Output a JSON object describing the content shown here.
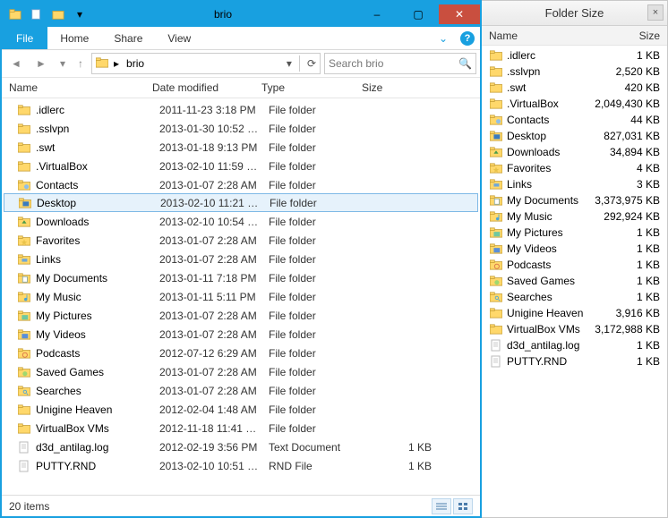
{
  "window": {
    "title": "brio",
    "minimize": "–",
    "maximize": "▢",
    "close": "✕"
  },
  "ribbon": {
    "file": "File",
    "home": "Home",
    "share": "Share",
    "view": "View"
  },
  "address": {
    "crumb_sep": "▸",
    "crumb": "brio",
    "refresh": "⟳"
  },
  "search": {
    "placeholder": "Search brio"
  },
  "columns": {
    "name": "Name",
    "date": "Date modified",
    "type": "Type",
    "size": "Size"
  },
  "selected_index": 5,
  "rows": [
    {
      "name": ".idlerc",
      "date": "2011-11-23 3:18 PM",
      "type": "File folder",
      "size": "",
      "icon": "folder"
    },
    {
      "name": ".sslvpn",
      "date": "2013-01-30 10:52 …",
      "type": "File folder",
      "size": "",
      "icon": "folder"
    },
    {
      "name": ".swt",
      "date": "2013-01-18 9:13 PM",
      "type": "File folder",
      "size": "",
      "icon": "folder"
    },
    {
      "name": ".VirtualBox",
      "date": "2013-02-10 11:59 …",
      "type": "File folder",
      "size": "",
      "icon": "folder"
    },
    {
      "name": "Contacts",
      "date": "2013-01-07 2:28 AM",
      "type": "File folder",
      "size": "",
      "icon": "contacts"
    },
    {
      "name": "Desktop",
      "date": "2013-02-10 11:21 …",
      "type": "File folder",
      "size": "",
      "icon": "desktop"
    },
    {
      "name": "Downloads",
      "date": "2013-02-10 10:54 …",
      "type": "File folder",
      "size": "",
      "icon": "downloads"
    },
    {
      "name": "Favorites",
      "date": "2013-01-07 2:28 AM",
      "type": "File folder",
      "size": "",
      "icon": "favorites"
    },
    {
      "name": "Links",
      "date": "2013-01-07 2:28 AM",
      "type": "File folder",
      "size": "",
      "icon": "links"
    },
    {
      "name": "My Documents",
      "date": "2013-01-11 7:18 PM",
      "type": "File folder",
      "size": "",
      "icon": "documents"
    },
    {
      "name": "My Music",
      "date": "2013-01-11 5:11 PM",
      "type": "File folder",
      "size": "",
      "icon": "music"
    },
    {
      "name": "My Pictures",
      "date": "2013-01-07 2:28 AM",
      "type": "File folder",
      "size": "",
      "icon": "pictures"
    },
    {
      "name": "My Videos",
      "date": "2013-01-07 2:28 AM",
      "type": "File folder",
      "size": "",
      "icon": "videos"
    },
    {
      "name": "Podcasts",
      "date": "2012-07-12 6:29 AM",
      "type": "File folder",
      "size": "",
      "icon": "podcasts"
    },
    {
      "name": "Saved Games",
      "date": "2013-01-07 2:28 AM",
      "type": "File folder",
      "size": "",
      "icon": "games"
    },
    {
      "name": "Searches",
      "date": "2013-01-07 2:28 AM",
      "type": "File folder",
      "size": "",
      "icon": "searches"
    },
    {
      "name": "Unigine Heaven",
      "date": "2012-02-04 1:48 AM",
      "type": "File folder",
      "size": "",
      "icon": "folder"
    },
    {
      "name": "VirtualBox VMs",
      "date": "2012-11-18 11:41 …",
      "type": "File folder",
      "size": "",
      "icon": "folder"
    },
    {
      "name": "d3d_antilag.log",
      "date": "2012-02-19 3:56 PM",
      "type": "Text Document",
      "size": "1 KB",
      "icon": "file"
    },
    {
      "name": "PUTTY.RND",
      "date": "2013-02-10 10:51 …",
      "type": "RND File",
      "size": "1 KB",
      "icon": "file"
    }
  ],
  "status": {
    "count": "20 items"
  },
  "side": {
    "title": "Folder Size",
    "close": "×",
    "col_name": "Name",
    "col_size": "Size",
    "rows": [
      {
        "name": ".idlerc",
        "size": "1 KB",
        "icon": "folder"
      },
      {
        "name": ".sslvpn",
        "size": "2,520 KB",
        "icon": "folder"
      },
      {
        "name": ".swt",
        "size": "420 KB",
        "icon": "folder"
      },
      {
        "name": ".VirtualBox",
        "size": "2,049,430 KB",
        "icon": "folder"
      },
      {
        "name": "Contacts",
        "size": "44 KB",
        "icon": "contacts"
      },
      {
        "name": "Desktop",
        "size": "827,031 KB",
        "icon": "desktop"
      },
      {
        "name": "Downloads",
        "size": "34,894 KB",
        "icon": "downloads"
      },
      {
        "name": "Favorites",
        "size": "4 KB",
        "icon": "favorites"
      },
      {
        "name": "Links",
        "size": "3 KB",
        "icon": "links"
      },
      {
        "name": "My Documents",
        "size": "3,373,975 KB",
        "icon": "documents"
      },
      {
        "name": "My Music",
        "size": "292,924 KB",
        "icon": "music"
      },
      {
        "name": "My Pictures",
        "size": "1 KB",
        "icon": "pictures"
      },
      {
        "name": "My Videos",
        "size": "1 KB",
        "icon": "videos"
      },
      {
        "name": "Podcasts",
        "size": "1 KB",
        "icon": "podcasts"
      },
      {
        "name": "Saved Games",
        "size": "1 KB",
        "icon": "games"
      },
      {
        "name": "Searches",
        "size": "1 KB",
        "icon": "searches"
      },
      {
        "name": "Unigine Heaven",
        "size": "3,916 KB",
        "icon": "folder"
      },
      {
        "name": "VirtualBox VMs",
        "size": "3,172,988 KB",
        "icon": "folder"
      },
      {
        "name": "d3d_antilag.log",
        "size": "1 KB",
        "icon": "file"
      },
      {
        "name": "PUTTY.RND",
        "size": "1 KB",
        "icon": "file"
      }
    ]
  }
}
